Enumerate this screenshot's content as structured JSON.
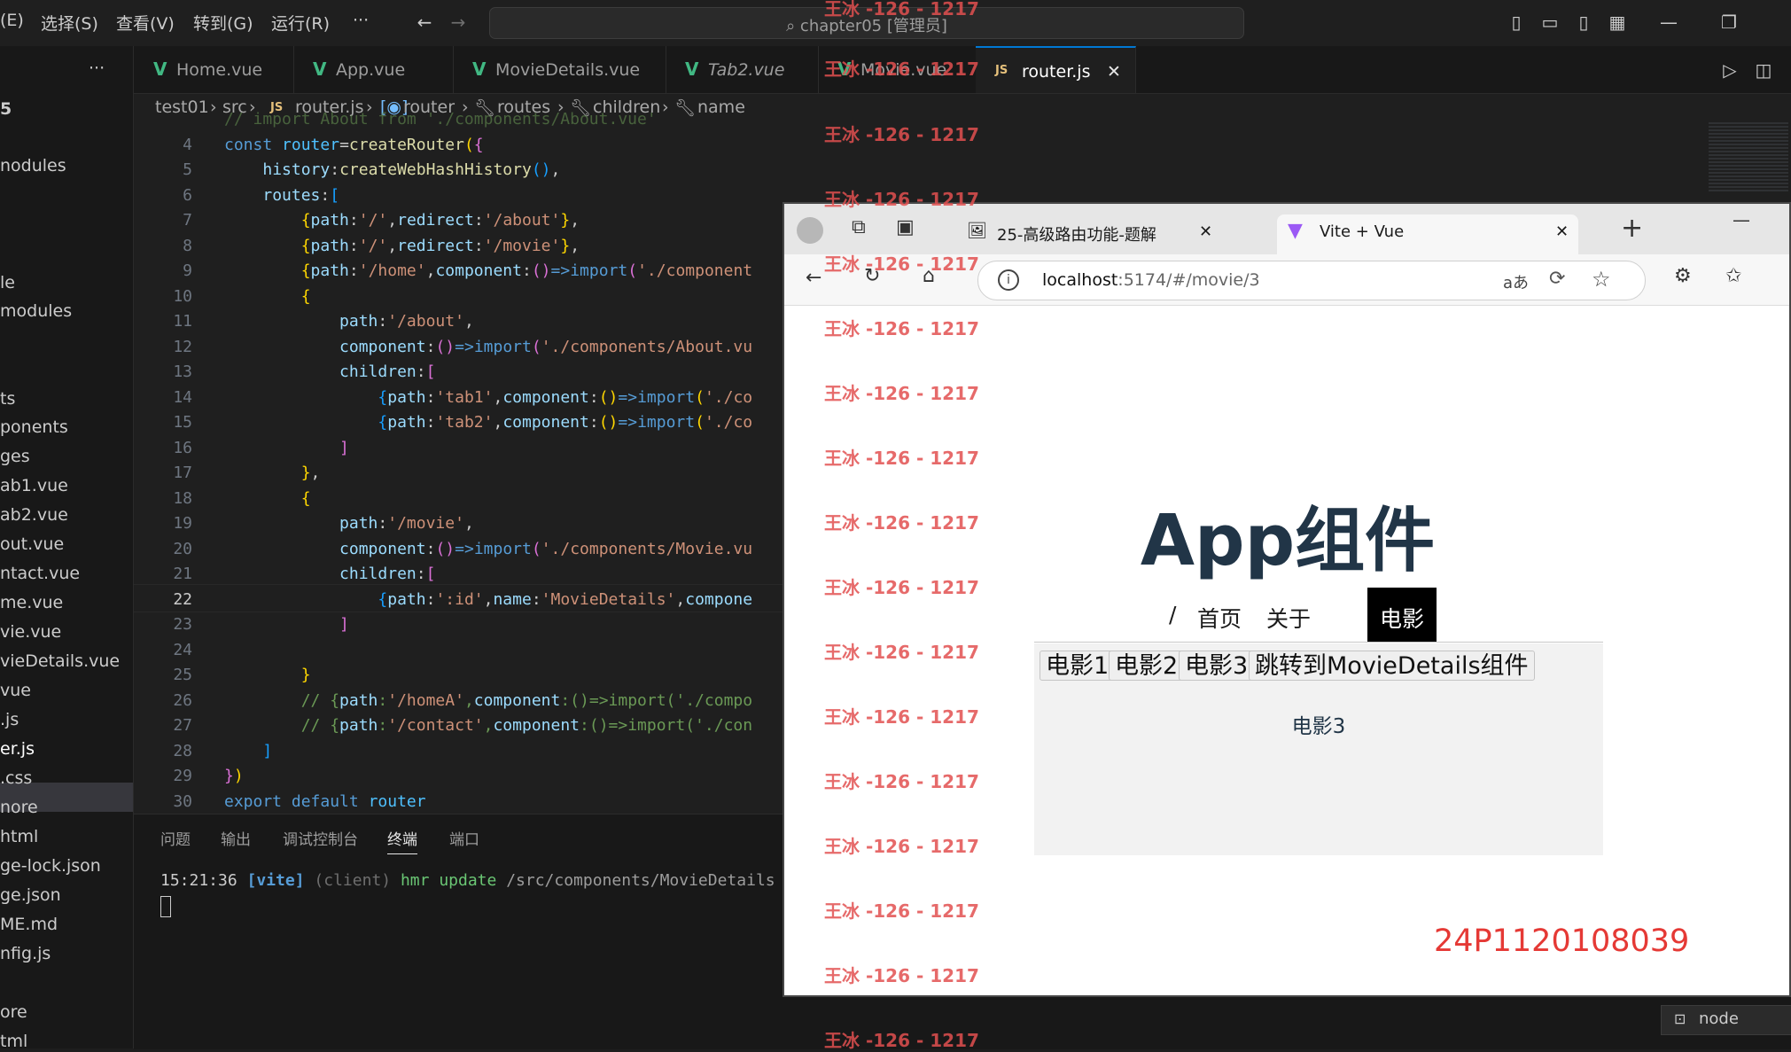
{
  "titlebar": {
    "menus": [
      "(E)",
      "选择(S)",
      "查看(V)",
      "转到(G)",
      "运行(R)",
      "···"
    ],
    "command_center": "chapter05 [管理员]"
  },
  "sidebar": {
    "more": "···",
    "items": [
      "5",
      "nodules",
      "le",
      "modules",
      "ts",
      "ponents",
      "ges",
      "ab1.vue",
      "ab2.vue",
      "out.vue",
      "ntact.vue",
      "me.vue",
      "vie.vue",
      "vieDetails.vue",
      "vue",
      ".js",
      "er.js",
      ".css",
      "nore",
      "html",
      "ge-lock.json",
      "ge.json",
      "ME.md",
      "nfig.js",
      "ore",
      "tml"
    ]
  },
  "tabs": [
    {
      "label": "Home.vue",
      "icon": "vue-icon"
    },
    {
      "label": "App.vue",
      "icon": "vue-icon"
    },
    {
      "label": "MovieDetails.vue",
      "icon": "vue-icon"
    },
    {
      "label": "Tab2.vue",
      "icon": "vue-icon"
    },
    {
      "label": "Movie.vue",
      "icon": "vue-icon"
    },
    {
      "label": "router.js",
      "icon": "js-icon",
      "close": "✕"
    }
  ],
  "breadcrumb": {
    "items": [
      "test01",
      "src",
      "router.js",
      "router",
      "routes",
      "children",
      "name"
    ],
    "js_badge": "JS",
    "sep": "›"
  },
  "editor": {
    "line_numbers": [
      "4",
      "5",
      "6",
      "7",
      "8",
      "9",
      "10",
      "11",
      "12",
      "13",
      "14",
      "15",
      "16",
      "17",
      "18",
      "19",
      "20",
      "21",
      "22",
      "23",
      "24",
      "25",
      "26",
      "27",
      "28",
      "29",
      "30"
    ],
    "current_line": "22",
    "partial_top_line": "// import About from './components/About.vue'"
  },
  "panel": {
    "tabs": [
      "问题",
      "输出",
      "调试控制台",
      "终端",
      "端口"
    ],
    "active_tab": "终端",
    "log": {
      "time": "15:21:36",
      "tag": "[vite]",
      "client": "(client)",
      "msg": "hmr update",
      "path": "/src/components/MovieDetails"
    },
    "node_label": "node"
  },
  "browser": {
    "tabs": [
      {
        "title": "25-高级路由功能-题解"
      },
      {
        "title": "Vite + Vue"
      }
    ],
    "close": "✕",
    "new_tab": "+",
    "minimize": "—",
    "url_host": "localhost",
    "url_rest": ":5174/#/movie/3",
    "read_aloud": "aあ"
  },
  "page": {
    "title": "App组件",
    "nav": [
      "/",
      "首页",
      "关于",
      "电影"
    ],
    "nav_active": "电影",
    "movie_buttons": [
      "电影1",
      "电影2",
      "电影3",
      "跳转到MovieDetails组件"
    ],
    "movie_content": "电影3",
    "student_id": "24P1120108039"
  },
  "watermark": "王冰 -126 - 1217",
  "colors": {
    "accent": "#0078d4",
    "vue_green": "#41b883",
    "watermark": "#e25050",
    "id_red": "#e53935"
  }
}
